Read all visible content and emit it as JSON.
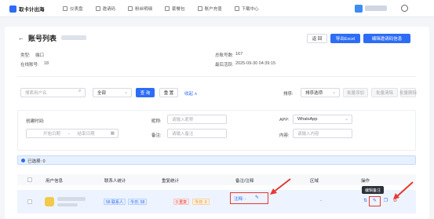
{
  "nav": {
    "brand": "取卡计出海",
    "items": [
      "仪表盘",
      "邀请码",
      "粉丝明细",
      "套餐包",
      "账户充值",
      "下载中心"
    ]
  },
  "header": {
    "back": "←",
    "title": "账号列表",
    "buttons": {
      "back": "返 回",
      "export": "导出Excel",
      "invite": "编辑邀请码信息"
    }
  },
  "info": {
    "type_label": "类型:",
    "type_value": "端口",
    "online_label": "在线账号:",
    "online_value": "18",
    "total_label": "总账号数:",
    "total_value": "167",
    "last_label": "最后活跃:",
    "last_value": "2025-09-30 04:39:15"
  },
  "search": {
    "account_placeholder": "搜索用户名",
    "all_select": "全部",
    "query": "查 询",
    "reset": "重 置",
    "collapse": "收起",
    "sort_label": "排序:",
    "sort_value": "排序选项",
    "batch_add": "批量添加",
    "batch_clear": "批量清除",
    "batch_delete": "批量删除"
  },
  "filters": {
    "created_label": "创建时间:",
    "start_placeholder": "开始日期",
    "sep": "→",
    "end_placeholder": "结束日期",
    "nickname_label": "昵称:",
    "nickname_placeholder": "请输入昵称",
    "remark_label": "备注:",
    "remark_placeholder": "请输入备注",
    "app_label": "APP:",
    "app_value": "WhatsApp",
    "content_label": "内容:",
    "content_placeholder": "请输入内容"
  },
  "selection": {
    "text": "已选择: 0"
  },
  "table": {
    "headers": [
      "用户信息",
      "联系人统计",
      "重复统计",
      "备注/注释",
      "区域",
      "操作"
    ],
    "row": {
      "contacts_total": "58 联系人",
      "contacts_today": "今日: 58",
      "dup_total": "0 重复",
      "dup_today": "今日: 0",
      "remark": "注释: -",
      "region": "-"
    }
  },
  "tooltip": "编辑备注",
  "colors": {
    "primary": "#2d6cf6",
    "annotation": "#e53935"
  },
  "icons": [
    "dashboard-icon",
    "invite-icon",
    "fans-icon",
    "package-icon",
    "recharge-icon",
    "download-icon",
    "globe-icon",
    "search-icon",
    "calendar-icon",
    "edit-icon",
    "copy-icon",
    "delete-icon"
  ]
}
